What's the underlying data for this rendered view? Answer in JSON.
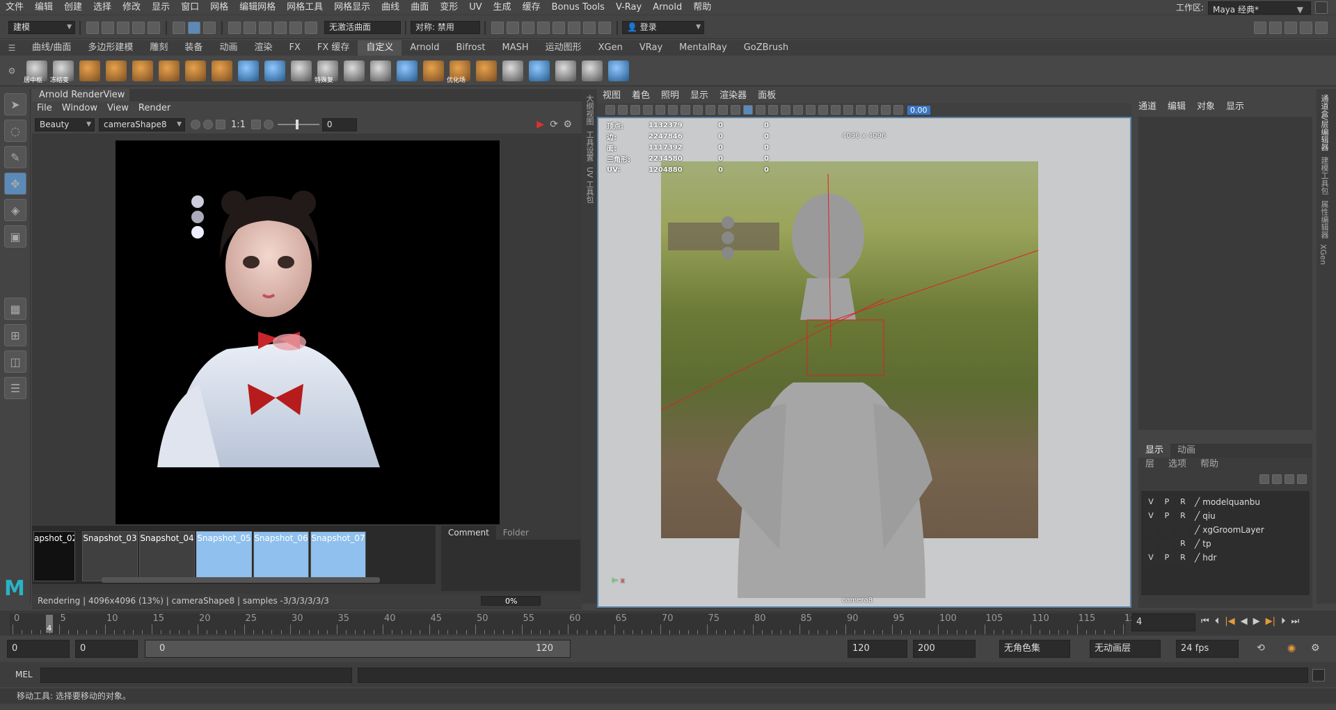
{
  "menubar": {
    "items": [
      "文件",
      "编辑",
      "创建",
      "选择",
      "修改",
      "显示",
      "窗口",
      "网格",
      "编辑网格",
      "网格工具",
      "网格显示",
      "曲线",
      "曲面",
      "变形",
      "UV",
      "生成",
      "缓存",
      "Bonus Tools",
      "V-Ray",
      "Arnold",
      "帮助"
    ],
    "workspace_label": "工作区:",
    "workspace_value": "Maya 经典*"
  },
  "statusline": {
    "mode": "建模",
    "live_surface": "无激活曲面",
    "symmetry": "对称: 禁用",
    "login": "登录"
  },
  "shelf": {
    "tabs": [
      "曲线/曲面",
      "多边形建模",
      "雕刻",
      "装备",
      "动画",
      "渲染",
      "FX",
      "FX 缓存",
      "自定义",
      "Arnold",
      "Bifrost",
      "MASH",
      "运动图形",
      "XGen",
      "VRay",
      "MentalRay",
      "GoZBrush"
    ],
    "active_tab": "自定义",
    "icon_labels": [
      "居中枢",
      "冻结变",
      "特殊复",
      "优化场"
    ]
  },
  "renderview": {
    "title": "Arnold RenderView",
    "menu": [
      "File",
      "Window",
      "View",
      "Render"
    ],
    "aov": "Beauty",
    "camera": "cameraShape8",
    "ratio": "1:1",
    "exposure": "0",
    "snapshots": [
      "apshot_02",
      "Snapshot_03",
      "Snapshot_04",
      "Snapshot_05",
      "Snapshot_06",
      "Snapshot_07"
    ],
    "comment_tabs": [
      "Comment",
      "Folder"
    ],
    "progress": "0%",
    "status": "Rendering | 4096x4096 (13%) | cameraShape8 | samples -3/3/3/3/3/3"
  },
  "side_tabs": [
    "大纲视图",
    "工具设置",
    "UV 工具包"
  ],
  "viewport": {
    "menu": [
      "视图",
      "着色",
      "照明",
      "显示",
      "渲染器",
      "面板"
    ],
    "gamma": "0.00",
    "resolution": "4096 x 4096",
    "camera": "camera8",
    "stats": [
      {
        "label": "顶点:",
        "v": "1132379",
        "a": "0",
        "b": "0"
      },
      {
        "label": "边:",
        "v": "2247846",
        "a": "0",
        "b": "0"
      },
      {
        "label": "面:",
        "v": "1117392",
        "a": "0",
        "b": "0"
      },
      {
        "label": "三角形:",
        "v": "2234580",
        "a": "0",
        "b": "0"
      },
      {
        "label": "UV:",
        "v": "1204880",
        "a": "0",
        "b": "0"
      }
    ]
  },
  "channelbox": {
    "menu": [
      "通道",
      "编辑",
      "对象",
      "显示"
    ]
  },
  "layers": {
    "tabs": [
      "显示",
      "动画"
    ],
    "menu": [
      "层",
      "选项",
      "帮助"
    ],
    "rows": [
      {
        "v": "V",
        "p": "P",
        "r": "R",
        "name": "modelquanbu"
      },
      {
        "v": "V",
        "p": "P",
        "r": "R",
        "name": "qiu"
      },
      {
        "v": "",
        "p": "",
        "r": "",
        "name": "xgGroomLayer"
      },
      {
        "v": "",
        "p": "",
        "r": "R",
        "name": "tp"
      },
      {
        "v": "V",
        "p": "P",
        "r": "R",
        "name": "hdr"
      }
    ]
  },
  "right_strip": [
    "通道盒/层编辑器",
    "建模工具包",
    "属性编辑器",
    "XGen"
  ],
  "timeline": {
    "ticks": [
      "0",
      "5",
      "10",
      "15",
      "20",
      "25",
      "30",
      "35",
      "40",
      "45",
      "50",
      "55",
      "60",
      "65",
      "70",
      "75",
      "80",
      "85",
      "90",
      "95",
      "100",
      "105",
      "110",
      "115",
      "120"
    ],
    "current": "4",
    "current_field": "4"
  },
  "range": {
    "start": "0",
    "start2": "0",
    "slider_start": "0",
    "slider_end": "120",
    "end": "120",
    "end2": "200",
    "char_set": "无角色集",
    "anim_layer": "无动画层",
    "fps": "24 fps"
  },
  "cmd": {
    "label": "MEL"
  },
  "help": {
    "text": "移动工具: 选择要移动的对象。"
  }
}
